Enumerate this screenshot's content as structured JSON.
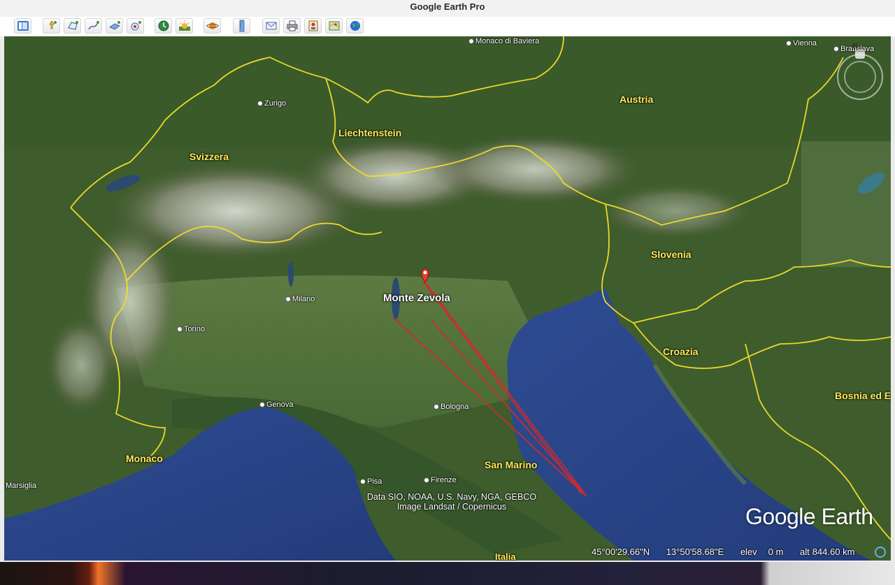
{
  "window": {
    "title": "Google Earth Pro"
  },
  "toolbar": {
    "buttons": [
      {
        "name": "sidebar-toggle-button",
        "icon": "sidebar-icon"
      },
      {
        "name": "add-placemark-button",
        "icon": "pushpin-icon"
      },
      {
        "name": "add-polygon-button",
        "icon": "polygon-icon"
      },
      {
        "name": "add-path-button",
        "icon": "path-icon"
      },
      {
        "name": "image-overlay-button",
        "icon": "image-overlay-icon"
      },
      {
        "name": "record-tour-button",
        "icon": "record-tour-icon"
      },
      {
        "name": "historical-imagery-button",
        "icon": "clock-icon"
      },
      {
        "name": "sunlight-button",
        "icon": "sun-icon"
      },
      {
        "name": "switch-planet-button",
        "icon": "planet-icon"
      },
      {
        "name": "ruler-button",
        "icon": "ruler-icon"
      },
      {
        "name": "email-button",
        "icon": "envelope-icon"
      },
      {
        "name": "print-button",
        "icon": "printer-icon"
      },
      {
        "name": "save-image-button",
        "icon": "save-image-icon"
      },
      {
        "name": "view-in-maps-button",
        "icon": "map-icon"
      },
      {
        "name": "earth-gallery-button",
        "icon": "globe-icon"
      }
    ]
  },
  "map": {
    "countries": [
      {
        "id": "austria",
        "text": "Austria"
      },
      {
        "id": "liechtenstein",
        "text": "Liechtenstein"
      },
      {
        "id": "svizzera",
        "text": "Svizzera"
      },
      {
        "id": "slovenia",
        "text": "Slovenia"
      },
      {
        "id": "croazia",
        "text": "Croazia"
      },
      {
        "id": "bosnia",
        "text": "Bosnia ed E"
      },
      {
        "id": "monaco",
        "text": "Monaco"
      },
      {
        "id": "san-marino",
        "text": "San Marino"
      },
      {
        "id": "italia",
        "text": "Italia"
      }
    ],
    "cities": [
      {
        "id": "monaco-di-baviera",
        "text": "Monaco di Baviera"
      },
      {
        "id": "vienna",
        "text": "Vienna"
      },
      {
        "id": "bratislava",
        "text": "Bratislava"
      },
      {
        "id": "zurigo",
        "text": "Zurigo"
      },
      {
        "id": "milano",
        "text": "Milano"
      },
      {
        "id": "torino",
        "text": "Torino"
      },
      {
        "id": "genova",
        "text": "Genova"
      },
      {
        "id": "bologna",
        "text": "Bologna"
      },
      {
        "id": "pisa",
        "text": "Pisa"
      },
      {
        "id": "firenze",
        "text": "Firenze"
      },
      {
        "id": "marsiglia",
        "text": "Marsiglia"
      }
    ],
    "placemark": {
      "text": "Monte Zevola",
      "icon": "map-pin-icon",
      "color": "#e53b2f"
    },
    "path_color": "#d42a2a",
    "attribution": {
      "line1": "Data SIO, NOAA, U.S. Navy, NGA, GEBCO",
      "line2": "Image Landsat / Copernicus"
    },
    "logo": "Google Earth",
    "compass_letter": "N"
  },
  "status": {
    "lat": "45°00'29.66\"N",
    "lon": "13°50'58.68\"E",
    "elev_label": "elev",
    "elev_value": "0 m",
    "alt_label": "alt",
    "alt_value": "844.60 km"
  }
}
